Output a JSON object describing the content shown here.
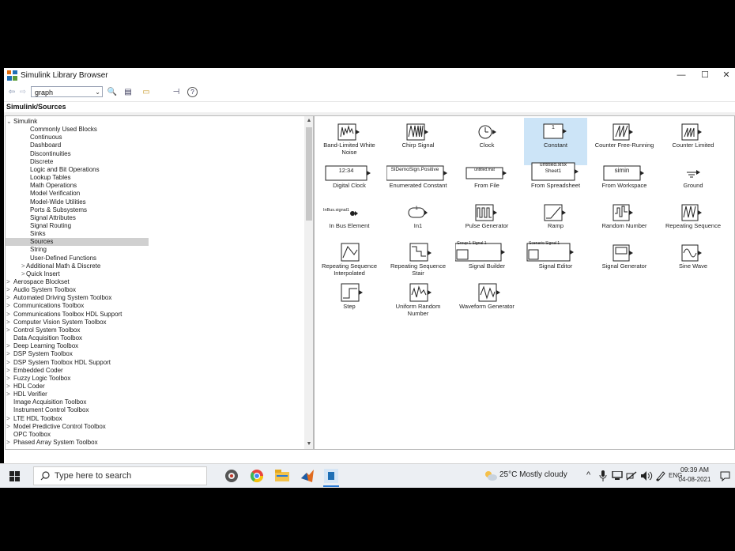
{
  "window": {
    "title": "Simulink Library Browser",
    "minimize": "—",
    "maximize": "☐",
    "close": "✕"
  },
  "toolbar": {
    "back": "⇦",
    "forward": "⇨",
    "search_value": "graph",
    "search_dropdown": "⌄",
    "find_icon": "🔍",
    "new_model": "▤",
    "open": "▭",
    "pin": "⊣",
    "help": "?"
  },
  "path": "Simulink/Sources",
  "tree": {
    "rows": [
      {
        "label": "Simulink",
        "level": 0,
        "arrow": "⌄"
      },
      {
        "label": "Commonly Used Blocks",
        "level": 2
      },
      {
        "label": "Continuous",
        "level": 2
      },
      {
        "label": "Dashboard",
        "level": 2
      },
      {
        "label": "Discontinuities",
        "level": 2
      },
      {
        "label": "Discrete",
        "level": 2
      },
      {
        "label": "Logic and Bit Operations",
        "level": 2
      },
      {
        "label": "Lookup Tables",
        "level": 2
      },
      {
        "label": "Math Operations",
        "level": 2
      },
      {
        "label": "Model Verification",
        "level": 2
      },
      {
        "label": "Model-Wide Utilities",
        "level": 2
      },
      {
        "label": "Ports & Subsystems",
        "level": 2
      },
      {
        "label": "Signal Attributes",
        "level": 2
      },
      {
        "label": "Signal Routing",
        "level": 2
      },
      {
        "label": "Sinks",
        "level": 2
      },
      {
        "label": "Sources",
        "level": 2,
        "selected": true
      },
      {
        "label": "String",
        "level": 2
      },
      {
        "label": "User-Defined Functions",
        "level": 2
      },
      {
        "label": "Additional Math & Discrete",
        "level": 1,
        "arrow": ">"
      },
      {
        "label": "Quick Insert",
        "level": 1,
        "arrow": ">"
      },
      {
        "label": "Aerospace Blockset",
        "level": 0,
        "arrow": ">"
      },
      {
        "label": "Audio System Toolbox",
        "level": 0,
        "arrow": ">"
      },
      {
        "label": "Automated Driving System Toolbox",
        "level": 0,
        "arrow": ">"
      },
      {
        "label": "Communications Toolbox",
        "level": 0,
        "arrow": ">"
      },
      {
        "label": "Communications Toolbox HDL Support",
        "level": 0,
        "arrow": ">"
      },
      {
        "label": "Computer Vision System Toolbox",
        "level": 0,
        "arrow": ">"
      },
      {
        "label": "Control System Toolbox",
        "level": 0,
        "arrow": ">"
      },
      {
        "label": "Data Acquisition Toolbox",
        "level": 0
      },
      {
        "label": "Deep Learning Toolbox",
        "level": 0,
        "arrow": ">"
      },
      {
        "label": "DSP System Toolbox",
        "level": 0,
        "arrow": ">"
      },
      {
        "label": "DSP System Toolbox HDL Support",
        "level": 0,
        "arrow": ">"
      },
      {
        "label": "Embedded Coder",
        "level": 0,
        "arrow": ">"
      },
      {
        "label": "Fuzzy Logic Toolbox",
        "level": 0,
        "arrow": ">"
      },
      {
        "label": "HDL Coder",
        "level": 0,
        "arrow": ">"
      },
      {
        "label": "HDL Verifier",
        "level": 0,
        "arrow": ">"
      },
      {
        "label": "Image Acquisition Toolbox",
        "level": 0
      },
      {
        "label": "Instrument Control Toolbox",
        "level": 0
      },
      {
        "label": "LTE HDL Toolbox",
        "level": 0,
        "arrow": ">"
      },
      {
        "label": "Model Predictive Control Toolbox",
        "level": 0,
        "arrow": ">"
      },
      {
        "label": "OPC Toolbox",
        "level": 0
      },
      {
        "label": "Phased Array System Toolbox",
        "level": 0,
        "arrow": ">"
      }
    ],
    "scroll_up": "▲",
    "scroll_down": "▼"
  },
  "blocks": [
    {
      "name": "band-limited-white-noise",
      "label": "Band-Limited White Noise",
      "icon_text": ""
    },
    {
      "name": "chirp-signal",
      "label": "Chirp Signal",
      "icon_text": ""
    },
    {
      "name": "clock",
      "label": "Clock",
      "icon_text": ""
    },
    {
      "name": "constant",
      "label": "Constant",
      "icon_text": "1",
      "selected": true
    },
    {
      "name": "counter-free-running",
      "label": "Counter Free-Running",
      "icon_text": ""
    },
    {
      "name": "counter-limited",
      "label": "Counter Limited",
      "icon_text": ""
    },
    {
      "name": "digital-clock",
      "label": "Digital Clock",
      "icon_text": "12:34"
    },
    {
      "name": "enumerated-constant",
      "label": "Enumerated Constant",
      "icon_text": "SlDemoSign.Positive"
    },
    {
      "name": "from-file",
      "label": "From File",
      "icon_text": "untitled.mat"
    },
    {
      "name": "from-spreadsheet",
      "label": "From Spreadsheet",
      "icon_text": "untitled.xlsx Sheet1"
    },
    {
      "name": "from-workspace",
      "label": "From Workspace",
      "icon_text": "simin"
    },
    {
      "name": "ground",
      "label": "Ground",
      "icon_text": ""
    },
    {
      "name": "in-bus-element",
      "label": "In Bus Element",
      "icon_text": "InBus.signal1"
    },
    {
      "name": "in1",
      "label": "In1",
      "icon_text": "1"
    },
    {
      "name": "pulse-generator",
      "label": "Pulse Generator",
      "icon_text": ""
    },
    {
      "name": "ramp",
      "label": "Ramp",
      "icon_text": ""
    },
    {
      "name": "random-number",
      "label": "Random Number",
      "icon_text": ""
    },
    {
      "name": "repeating-sequence",
      "label": "Repeating Sequence",
      "icon_text": ""
    },
    {
      "name": "repeating-sequence-interpolated",
      "label": "Repeating Sequence Interpolated",
      "icon_text": ""
    },
    {
      "name": "repeating-sequence-stair",
      "label": "Repeating Sequence Stair",
      "icon_text": ""
    },
    {
      "name": "signal-builder",
      "label": "Signal Builder",
      "icon_text": "Group 1 Signal 1"
    },
    {
      "name": "signal-editor",
      "label": "Signal Editor",
      "icon_text": "Scenario Signal 1"
    },
    {
      "name": "signal-generator",
      "label": "Signal Generator",
      "icon_text": ""
    },
    {
      "name": "sine-wave",
      "label": "Sine Wave",
      "icon_text": ""
    },
    {
      "name": "step",
      "label": "Step",
      "icon_text": ""
    },
    {
      "name": "uniform-random-number",
      "label": "Uniform Random Number",
      "icon_text": ""
    },
    {
      "name": "waveform-generator",
      "label": "Waveform Generator",
      "icon_text": ""
    }
  ],
  "taskbar": {
    "search_placeholder": "Type here to search",
    "weather": "25°C  Mostly cloudy",
    "tray_arrow": "^",
    "language": "ENG",
    "time": "09:39 AM",
    "date": "04-08-2021"
  },
  "colors": {
    "selection": "#cce4f7",
    "tree_selection": "#d0d0d0",
    "taskbar": "#eceff3"
  }
}
